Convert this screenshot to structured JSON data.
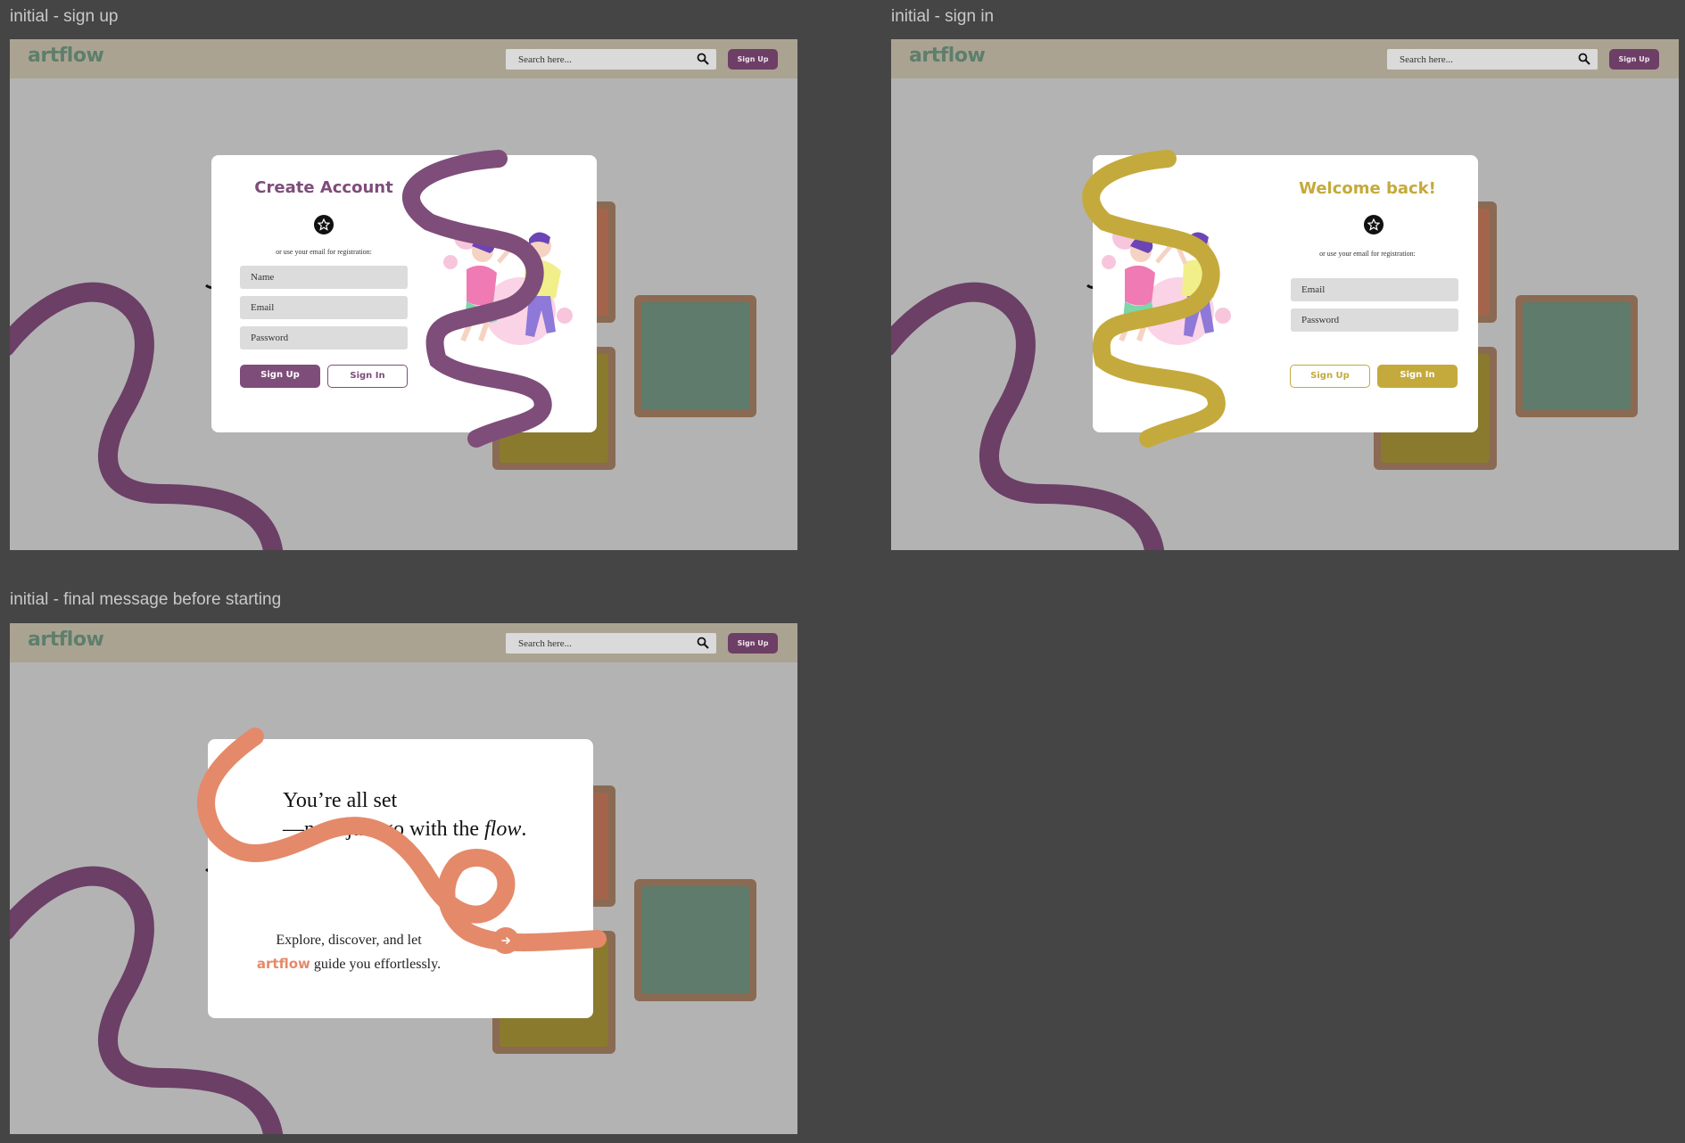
{
  "frames": {
    "signup_label": "initial - sign up",
    "signin_label": "initial - sign in",
    "final_label": "initial - final message before starting"
  },
  "navbar": {
    "logo": "artflow",
    "search_placeholder": "Search here...",
    "signup_button": "Sign Up"
  },
  "signup_card": {
    "title": "Create Account",
    "hint": "or use your email for registration:",
    "name_placeholder": "Name",
    "email_placeholder": "Email",
    "password_placeholder": "Password",
    "signup_button": "Sign Up",
    "signin_button": "Sign In"
  },
  "signin_card": {
    "title": "Welcome back!",
    "hint": "or use your email for registration:",
    "email_placeholder": "Email",
    "password_placeholder": "Password",
    "signup_button": "Sign Up",
    "signin_button": "Sign In"
  },
  "final_card": {
    "line1": "You’re all set",
    "line2_prefix": "—now just go with the ",
    "line2_italic": "flow",
    "line2_suffix": ".",
    "sub_line1": "Explore, discover, and let",
    "sub_brand": "artflow",
    "sub_line2_rest": " guide you effortlessly."
  },
  "icons": {
    "search": "search-icon",
    "social": "star-badge-icon",
    "arrow": "arrow-right-icon"
  },
  "colors": {
    "canvas": "#454545",
    "frame_bg": "#b3b3b3",
    "navbar": "#aba392",
    "logo_green": "#5d7f6c",
    "purple": "#7e4d7a",
    "mustard": "#c4aa3c",
    "coral": "#e48a6a",
    "tile_brown": "#a4644c",
    "tile_teal": "#5e7b6c",
    "tile_olive": "#8a7a2e"
  }
}
